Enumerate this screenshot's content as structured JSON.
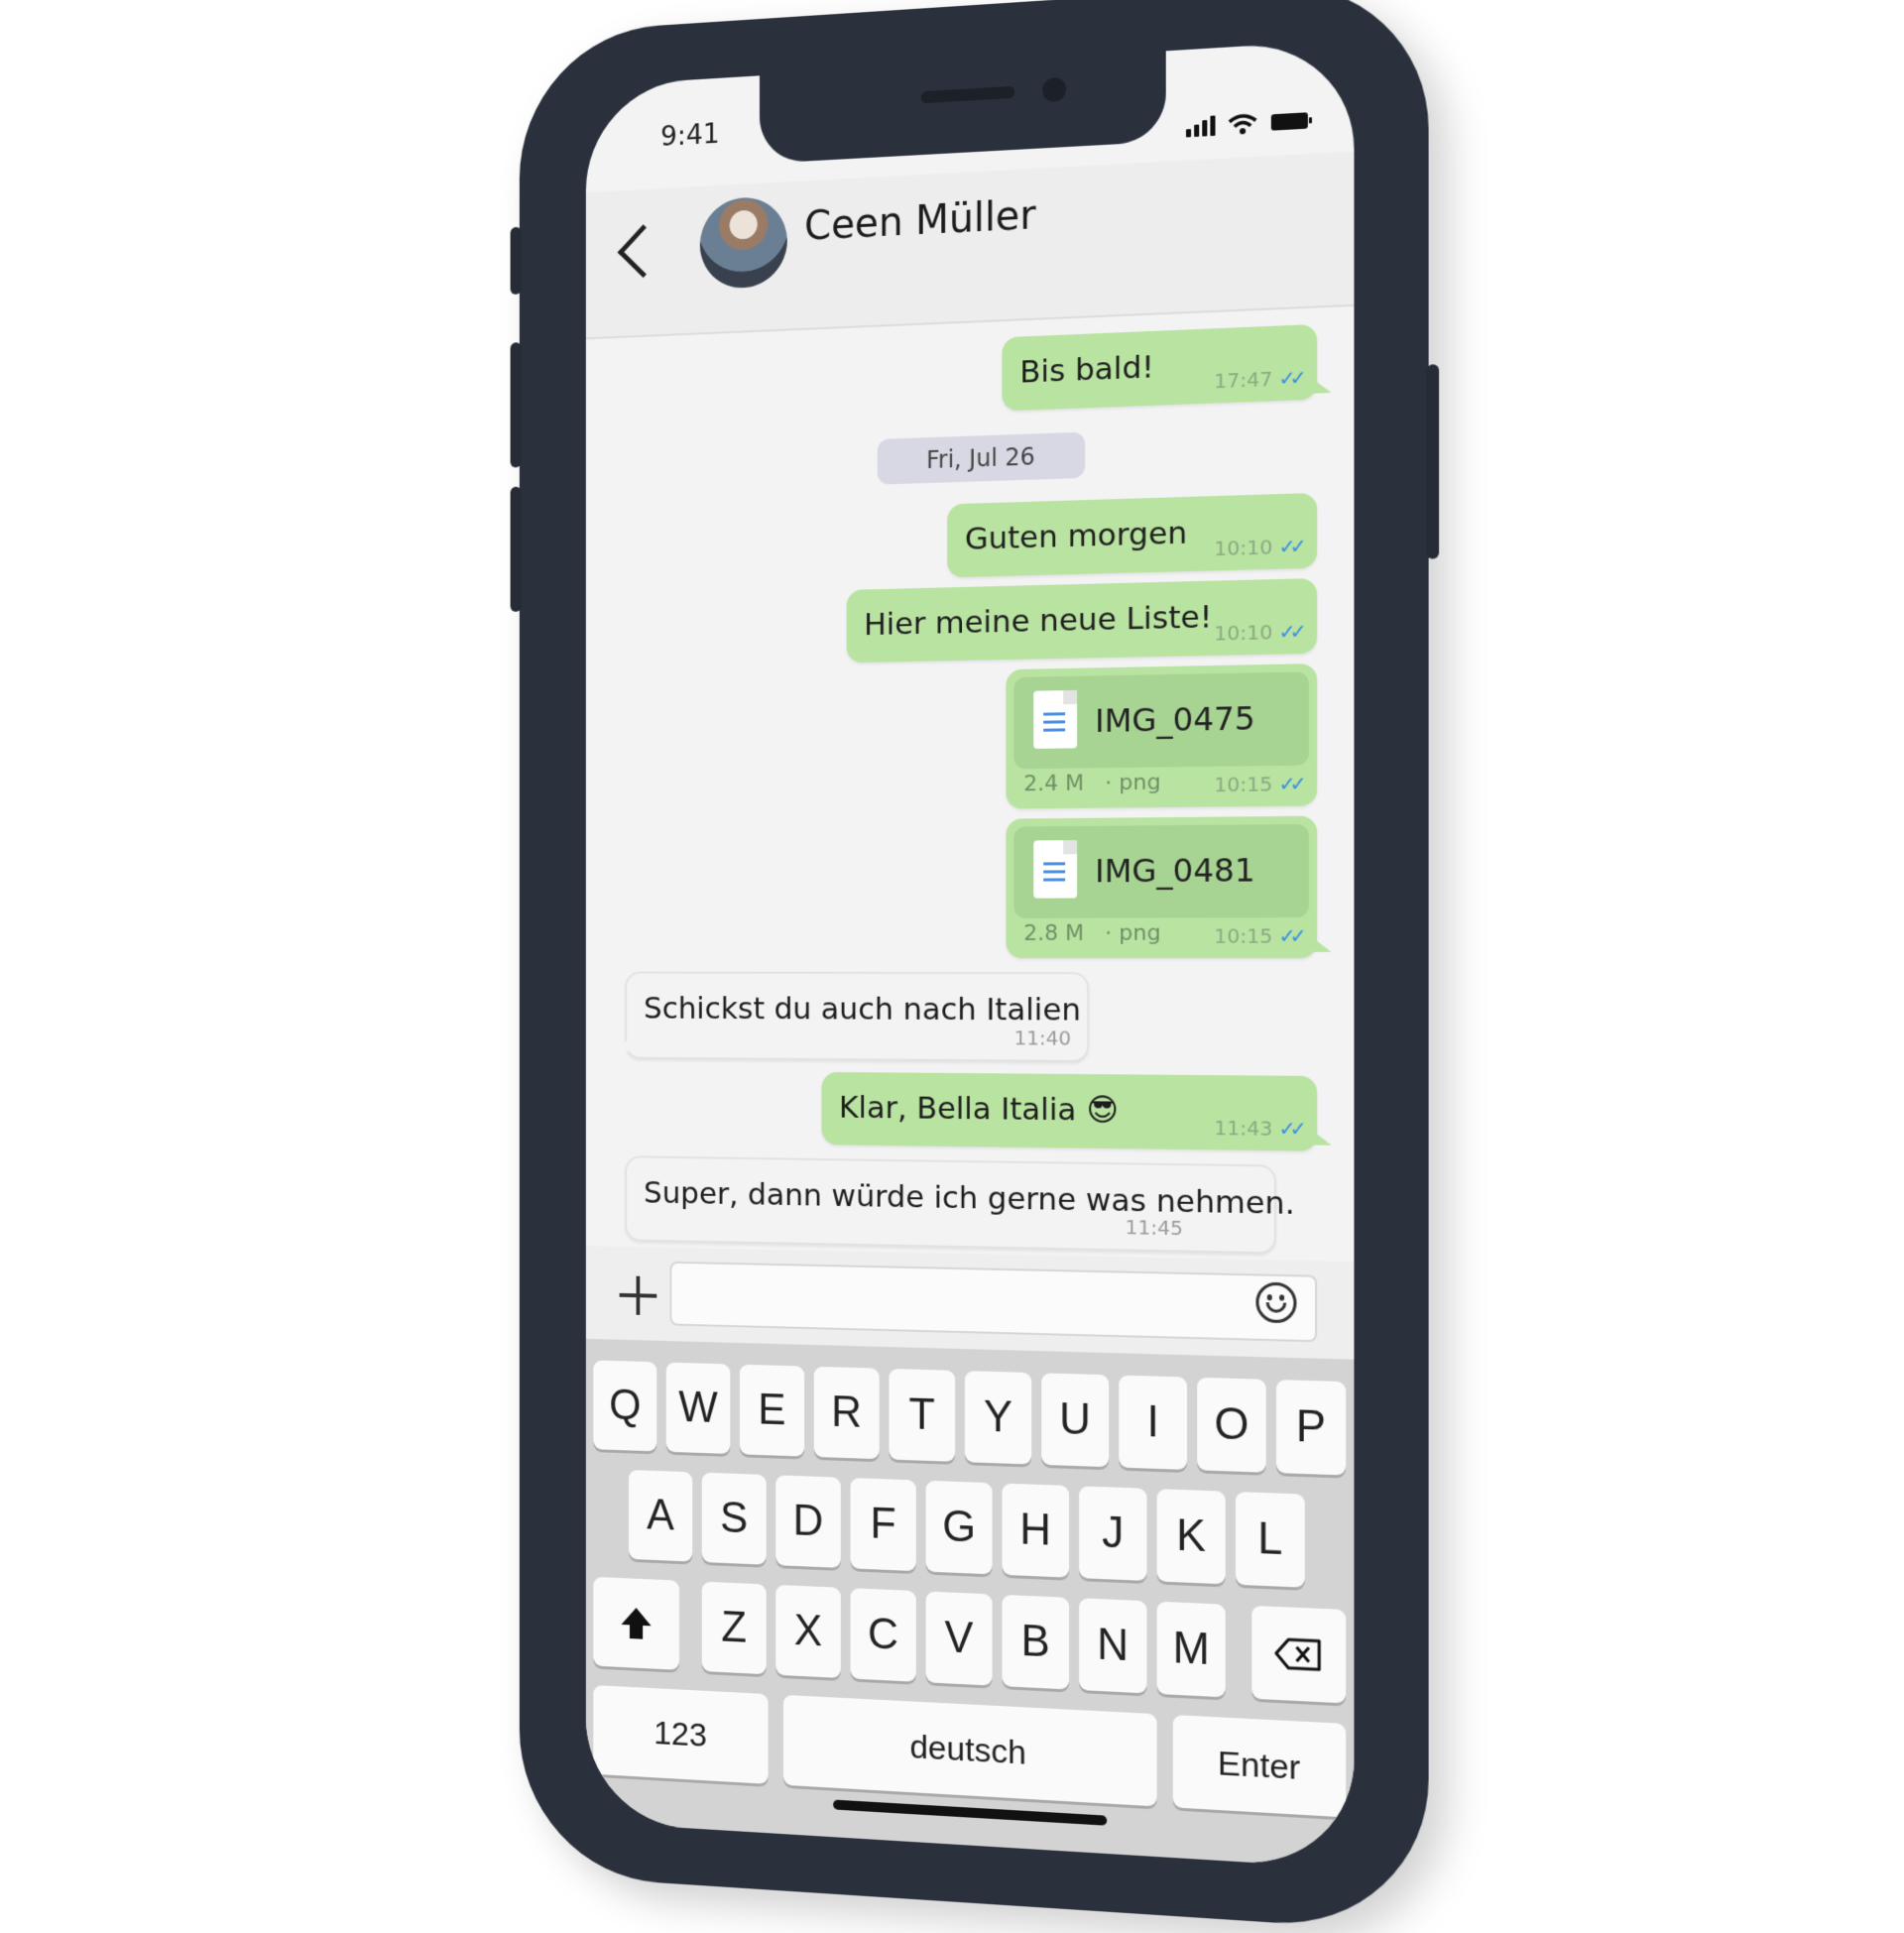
{
  "status": {
    "time": "9:41"
  },
  "contact": {
    "name": "Ceen Müller"
  },
  "messages": [
    {
      "text": "Bis bald!",
      "time": "17:47"
    },
    {
      "date": "Fri, Jul 26"
    },
    {
      "text": "Guten morgen",
      "time": "10:10"
    },
    {
      "text": "Hier meine neue Liste!",
      "time": "10:10"
    },
    {
      "file": "IMG_0475",
      "size": "2.4 M",
      "type": "png",
      "time": "10:15"
    },
    {
      "file": "IMG_0481",
      "size": "2.8 M",
      "type": "png",
      "time": "10:15"
    },
    {
      "text": "Schickst du auch nach Italien",
      "time": "11:40"
    },
    {
      "text": "Klar, Bella Italia 😎",
      "time": "11:43"
    },
    {
      "text": "Super, dann würde ich gerne was nehmen.",
      "time": "11:45"
    }
  ],
  "composer": {
    "placeholder": ""
  },
  "keyboard": {
    "row1": [
      "Q",
      "W",
      "E",
      "R",
      "T",
      "Y",
      "U",
      "I",
      "O",
      "P"
    ],
    "row2": [
      "A",
      "S",
      "D",
      "F",
      "G",
      "H",
      "J",
      "K",
      "L"
    ],
    "row3": [
      "Z",
      "X",
      "C",
      "V",
      "B",
      "N",
      "M"
    ],
    "numbers": "123",
    "space": "deutsch",
    "enter": "Enter",
    "shift_icon": "shift-icon",
    "delete_icon": "backspace-icon"
  },
  "colors": {
    "outgoing": "#b9e3a1",
    "incoming": "#f3f3f3",
    "ticks": "#3a8ee6"
  }
}
